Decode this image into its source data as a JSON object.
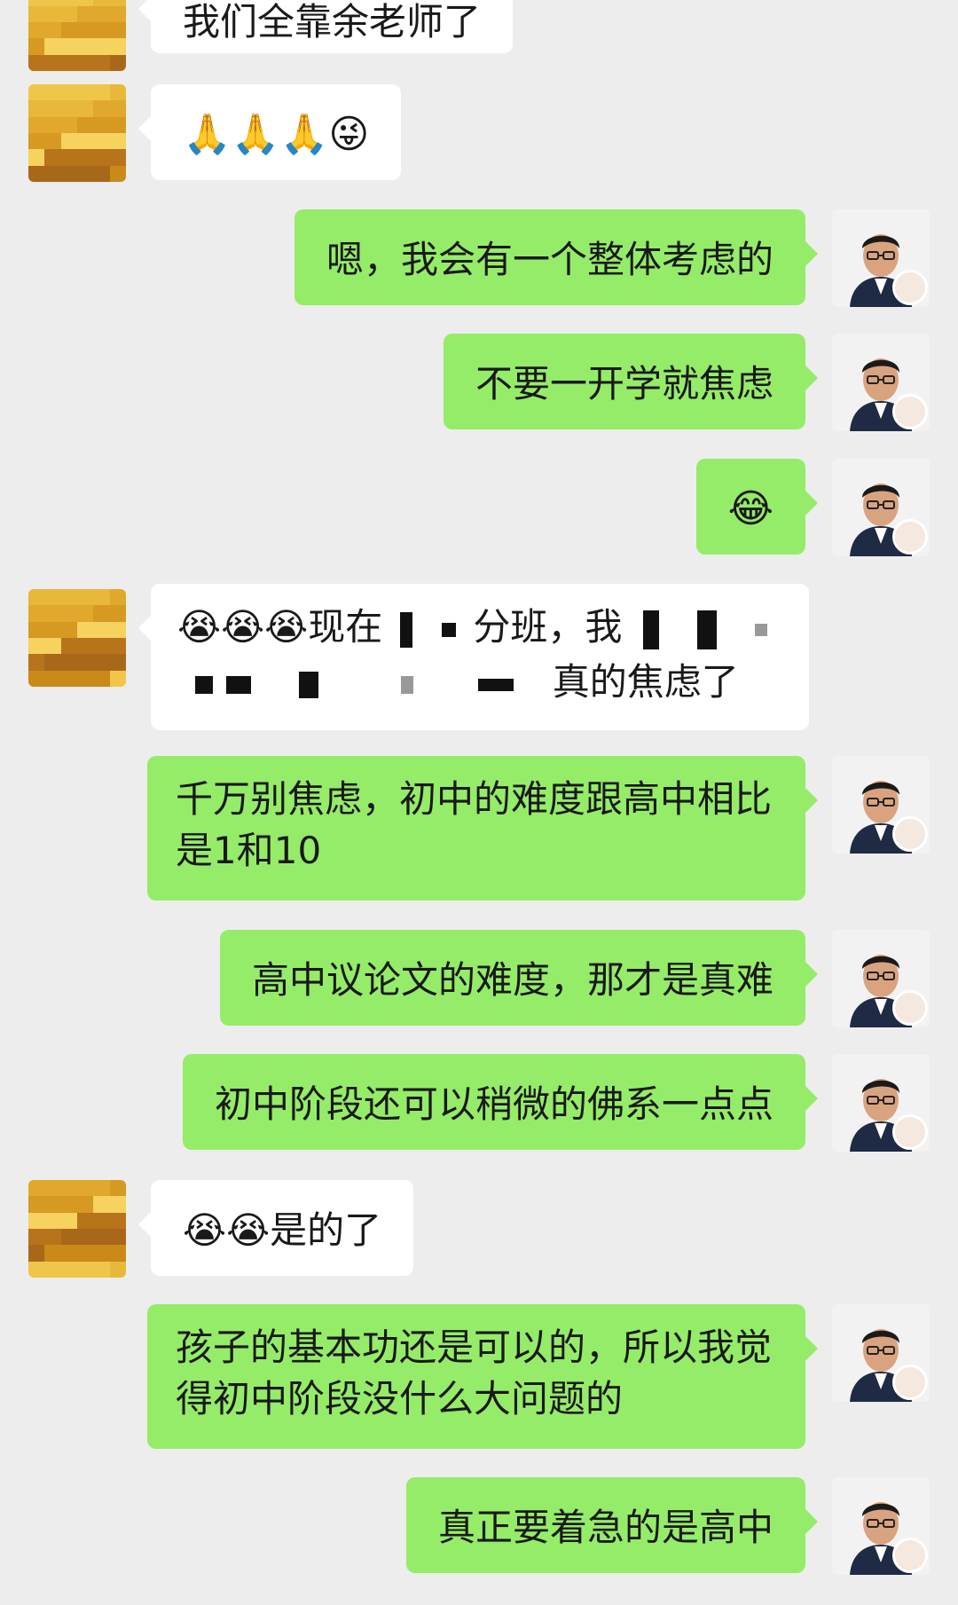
{
  "messages": [
    {
      "side": "in",
      "text": "我们全靠余老师了"
    },
    {
      "side": "in",
      "text": "🙏🙏🙏😜"
    },
    {
      "side": "out",
      "text": "嗯，我会有一个整体考虑的"
    },
    {
      "side": "out",
      "text": "不要一开学就焦虑"
    },
    {
      "side": "out",
      "text": "😂"
    },
    {
      "side": "in",
      "line1": "😭😭😭现在",
      "line1b": "分班，我",
      "line2": "真的焦虑了"
    },
    {
      "side": "out",
      "text": "千万别焦虑，初中的难度跟高中相比是1和10"
    },
    {
      "side": "out",
      "text": "高中议论文的难度，那才是真难"
    },
    {
      "side": "out",
      "text": "初中阶段还可以稍微的佛系一点点"
    },
    {
      "side": "in",
      "text": "😭😭是的了"
    },
    {
      "side": "out",
      "text": "孩子的基本功还是可以的，所以我觉得初中阶段没什么大问题的"
    },
    {
      "side": "out",
      "text": "真正要着急的是高中"
    }
  ],
  "colors": {
    "background": "#ededed",
    "outgoing": "#95ec69",
    "incoming": "#ffffff"
  }
}
